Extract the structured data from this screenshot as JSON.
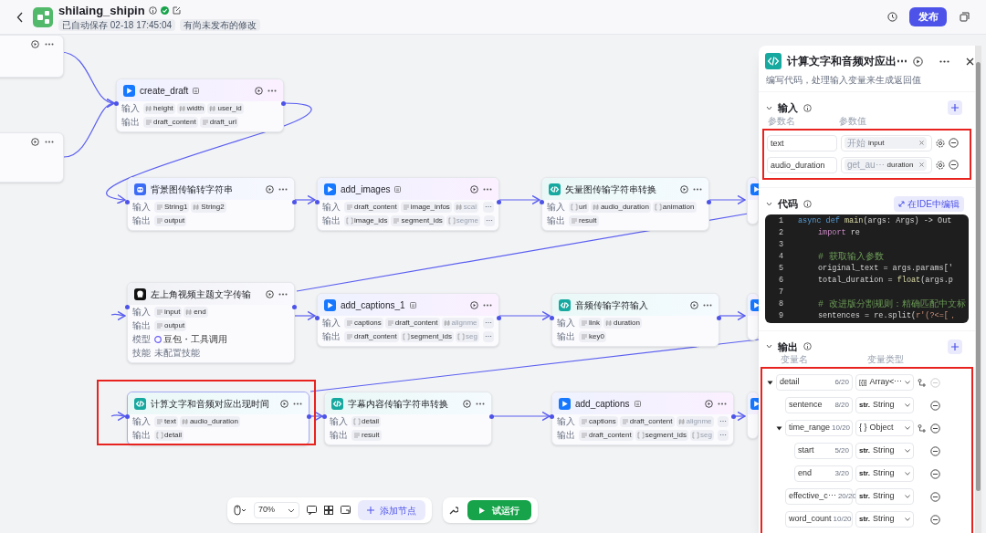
{
  "header": {
    "title": "shilaing_shipin",
    "saved": "已自动保存 02-18 17:45:04",
    "unpublished": "有尚未发布的修改",
    "publish": "发布"
  },
  "nodes": [
    {
      "kind": "stub"
    },
    {
      "kind": "stub"
    },
    {
      "kind": "plugin",
      "title": "create_draft",
      "plugin_badge": true,
      "selected": false,
      "highlighted": false,
      "rows": [
        {
          "label": "输入",
          "chips": [
            {
              "kind": "number",
              "name": "height"
            },
            {
              "kind": "number",
              "name": "width"
            },
            {
              "kind": "number",
              "name": "user_id"
            }
          ]
        },
        {
          "label": "输出",
          "chips": [
            {
              "kind": "string",
              "name": "draft_content"
            },
            {
              "kind": "string",
              "name": "draft_url"
            }
          ]
        }
      ]
    },
    {
      "kind": "app",
      "title": "背景图传输转字符串",
      "plugin_badge": false,
      "selected": false,
      "highlighted": false,
      "rows": [
        {
          "label": "输入",
          "chips": [
            {
              "kind": "string",
              "name": "String1"
            },
            {
              "kind": "number",
              "name": "String2"
            }
          ]
        },
        {
          "label": "输出",
          "chips": [
            {
              "kind": "string",
              "name": "output"
            }
          ]
        }
      ]
    },
    {
      "kind": "plugin",
      "title": "add_images",
      "plugin_badge": true,
      "selected": false,
      "highlighted": false,
      "rows": [
        {
          "label": "输入",
          "more": "⋯",
          "chips": [
            {
              "kind": "string",
              "name": "draft_content"
            },
            {
              "kind": "string",
              "name": "image_infos"
            },
            {
              "kind": "number",
              "name": "scal",
              "faded": true
            }
          ]
        },
        {
          "label": "输出",
          "more": "⋯",
          "chips": [
            {
              "kind": "array",
              "name": "image_ids"
            },
            {
              "kind": "string",
              "name": "segment_ids"
            },
            {
              "kind": "array",
              "name": "segme",
              "faded": true
            }
          ]
        }
      ]
    },
    {
      "kind": "code",
      "title": "矢量图传输字符串转换",
      "plugin_badge": false,
      "selected": false,
      "highlighted": false,
      "rows": [
        {
          "label": "输入",
          "chips": [
            {
              "kind": "array",
              "name": "url"
            },
            {
              "kind": "number",
              "name": "audio_duration"
            },
            {
              "kind": "array",
              "name": "animation"
            }
          ]
        },
        {
          "label": "输出",
          "chips": [
            {
              "kind": "string",
              "name": "result"
            }
          ]
        }
      ]
    },
    {
      "kind": "plugin"
    },
    {
      "kind": "llm",
      "title": "左上角视频主题文字传输",
      "plugin_badge": false,
      "selected": false,
      "highlighted": false,
      "rows": [
        {
          "label": "输入",
          "chips": [
            {
              "kind": "string",
              "name": "input"
            },
            {
              "kind": "number",
              "name": "end"
            }
          ]
        },
        {
          "label": "输出",
          "chips": [
            {
              "kind": "string",
              "name": "output"
            }
          ]
        },
        {
          "label": "模型",
          "model": "豆包・工具调用"
        },
        {
          "label": "技能",
          "note": "未配置技能"
        }
      ]
    },
    {
      "kind": "plugin",
      "title": "add_captions_1",
      "plugin_badge": true,
      "selected": false,
      "highlighted": false,
      "rows": [
        {
          "label": "输入",
          "more": "⋯",
          "chips": [
            {
              "kind": "string",
              "name": "captions"
            },
            {
              "kind": "string",
              "name": "draft_content"
            },
            {
              "kind": "number",
              "name": "alignme",
              "faded": true
            }
          ]
        },
        {
          "label": "输出",
          "more": "⋯",
          "chips": [
            {
              "kind": "string",
              "name": "draft_content"
            },
            {
              "kind": "array",
              "name": "segment_ids"
            },
            {
              "kind": "array",
              "name": "seg",
              "faded": true
            }
          ]
        }
      ]
    },
    {
      "kind": "code",
      "title": "音频传输字符输入",
      "plugin_badge": false,
      "selected": false,
      "highlighted": false,
      "rows": [
        {
          "label": "输入",
          "chips": [
            {
              "kind": "string",
              "name": "link"
            },
            {
              "kind": "number",
              "name": "duration"
            }
          ]
        },
        {
          "label": "输出",
          "chips": [
            {
              "kind": "string",
              "name": "key0"
            }
          ]
        }
      ]
    },
    {
      "kind": "plugin"
    },
    {
      "kind": "code",
      "title": "计算文字和音频对应出现时间",
      "plugin_badge": false,
      "selected": true,
      "highlighted": true,
      "rows": [
        {
          "label": "输入",
          "chips": [
            {
              "kind": "string",
              "name": "text"
            },
            {
              "kind": "number",
              "name": "audio_duration"
            }
          ]
        },
        {
          "label": "输出",
          "chips": [
            {
              "kind": "array",
              "name": "detail"
            }
          ]
        }
      ]
    },
    {
      "kind": "code",
      "title": "字幕内容传输字符串转换",
      "plugin_badge": false,
      "selected": false,
      "highlighted": false,
      "rows": [
        {
          "label": "输入",
          "chips": [
            {
              "kind": "array",
              "name": "detail"
            }
          ]
        },
        {
          "label": "输出",
          "chips": [
            {
              "kind": "string",
              "name": "result"
            }
          ]
        }
      ]
    },
    {
      "kind": "plugin",
      "title": "add_captions",
      "plugin_badge": true,
      "selected": false,
      "highlighted": false,
      "rows": [
        {
          "label": "输入",
          "more": "⋯",
          "chips": [
            {
              "kind": "string",
              "name": "captions"
            },
            {
              "kind": "string",
              "name": "draft_content"
            },
            {
              "kind": "number",
              "name": "alignme",
              "faded": true
            }
          ]
        },
        {
          "label": "输出",
          "more": "⋯",
          "chips": [
            {
              "kind": "string",
              "name": "draft_content"
            },
            {
              "kind": "array",
              "name": "segment_ids"
            },
            {
              "kind": "array",
              "name": "seg",
              "faded": true
            }
          ]
        }
      ]
    },
    {
      "kind": "plugin"
    }
  ],
  "toolbar": {
    "zoom": "70%",
    "add_node": "添加节点",
    "test_run": "试运行"
  },
  "panel": {
    "title": "计算文字和音频对应出⋯",
    "description": "编写代码，处理输入变量来生成返回值",
    "inputs": {
      "title": "输入",
      "col_name": "参数名",
      "col_value": "参数值",
      "highlighted": true,
      "rows": [
        {
          "name": "text",
          "source": "开始",
          "var": "input"
        },
        {
          "name": "audio_duration",
          "source": "get_au⋯",
          "var": "duration"
        }
      ]
    },
    "code": {
      "title": "代码",
      "ide_button": "在IDE中编辑",
      "lines": [
        {
          "number": "1",
          "indented": false,
          "tokens": [
            {
              "kind": "keyword",
              "text": "async def "
            },
            {
              "kind": "function",
              "text": "main"
            },
            {
              "kind": "plain",
              "text": "(args: Args) -> Out"
            }
          ]
        },
        {
          "number": "2",
          "indented": true,
          "tokens": [
            {
              "kind": "import",
              "text": "import"
            },
            {
              "kind": "plain",
              "text": " re"
            }
          ]
        },
        {
          "number": "3"
        },
        {
          "number": "4",
          "indented": true,
          "tokens": [
            {
              "kind": "comment",
              "text": "# 获取输入参数"
            }
          ]
        },
        {
          "number": "5",
          "indented": true,
          "tokens": [
            {
              "kind": "plain",
              "text": "original_text = args.params['"
            }
          ]
        },
        {
          "number": "6",
          "indented": true,
          "tokens": [
            {
              "kind": "plain",
              "text": "total_duration = "
            },
            {
              "kind": "function",
              "text": "float"
            },
            {
              "kind": "plain",
              "text": "(args.p"
            }
          ]
        },
        {
          "number": "7"
        },
        {
          "number": "8",
          "indented": true,
          "tokens": [
            {
              "kind": "comment",
              "text": "# 改进版分割规则：精确匹配中文标"
            }
          ]
        },
        {
          "number": "9",
          "indented": true,
          "tokens": [
            {
              "kind": "plain",
              "text": "sentences = re.split("
            },
            {
              "kind": "string",
              "text": "r'(?<=[，"
            }
          ]
        }
      ]
    },
    "outputs": {
      "title": "输出",
      "col_name": "变量名",
      "col_type": "变量类型",
      "highlighted": true,
      "rows": [
        {
          "name": "detail",
          "count": "6/20",
          "type_icon": "[{}]",
          "type": "Array<⋯",
          "kind": "array",
          "expanded": true,
          "disabled": true,
          "children": [
            {
              "name": "sentence",
              "count": "8/20",
              "type_icon": "str.",
              "type": "String",
              "kind": "string",
              "disabled": false
            },
            {
              "name": "time_range",
              "count": "10/20",
              "type_icon": "{ }",
              "type": "Object",
              "kind": "object",
              "expanded": true,
              "disabled": false,
              "children": [
                {
                  "name": "start",
                  "count": "5/20",
                  "type_icon": "str.",
                  "type": "String",
                  "kind": "string",
                  "disabled": false
                },
                {
                  "name": "end",
                  "count": "3/20",
                  "type_icon": "str.",
                  "type": "String",
                  "kind": "string",
                  "disabled": false
                }
              ]
            },
            {
              "name": "effective_c⋯",
              "count": "20/20",
              "type_icon": "str.",
              "type": "String",
              "kind": "string",
              "disabled": false
            },
            {
              "name": "word_count",
              "count": "10/20",
              "type_icon": "str.",
              "type": "String",
              "kind": "string",
              "disabled": false
            }
          ]
        }
      ]
    }
  }
}
